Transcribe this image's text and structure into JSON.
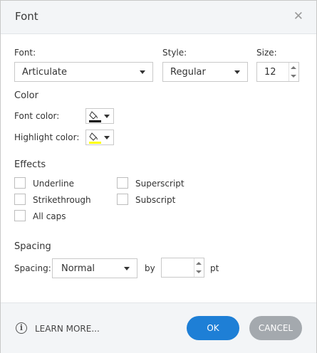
{
  "dialog": {
    "title": "Font"
  },
  "font": {
    "label": "Font:",
    "value": "Articulate",
    "style_label": "Style:",
    "style_value": "Regular",
    "size_label": "Size:",
    "size_value": "12"
  },
  "color": {
    "heading": "Color",
    "font_color_label": "Font color:",
    "font_color_swatch": "#000000",
    "highlight_label": "Highlight color:",
    "highlight_swatch": "#ffff00"
  },
  "effects": {
    "heading": "Effects",
    "underline": "Underline",
    "superscript": "Superscript",
    "strikethrough": "Strikethrough",
    "subscript": "Subscript",
    "all_caps": "All caps"
  },
  "spacing": {
    "heading": "Spacing",
    "label": "Spacing:",
    "value": "Normal",
    "by_label": "by",
    "by_value": "",
    "unit": "pt"
  },
  "footer": {
    "learn_more": "LEARN MORE...",
    "ok": "OK",
    "cancel": "CANCEL"
  },
  "colors": {
    "accent": "#1e7fd6",
    "cancel_bg": "#a4a9ae",
    "titlebar_bg": "#f3f5f7"
  }
}
